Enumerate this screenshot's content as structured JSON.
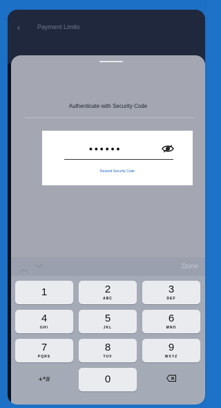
{
  "nav": {
    "title": "Payment Limits",
    "back_icon": "chevron-left-icon"
  },
  "sheet": {
    "auth_title": "Authenticate with Security Code",
    "code_value": "••••••",
    "eye_icon": "eye-icon",
    "resend_label": "Resend Security Code"
  },
  "toolbar": {
    "done_label": "Done",
    "up_icon": "chevron-up-icon",
    "down_icon": "chevron-down-icon"
  },
  "keypad": {
    "rows": [
      [
        {
          "num": "1",
          "sub": ""
        },
        {
          "num": "2",
          "sub": "ABC"
        },
        {
          "num": "3",
          "sub": "DEF"
        }
      ],
      [
        {
          "num": "4",
          "sub": "GHI"
        },
        {
          "num": "5",
          "sub": "JKL"
        },
        {
          "num": "6",
          "sub": "MNO"
        }
      ],
      [
        {
          "num": "7",
          "sub": "PQRS"
        },
        {
          "num": "8",
          "sub": "TUV"
        },
        {
          "num": "9",
          "sub": "WXYZ"
        }
      ]
    ],
    "symbols_label": "+*#",
    "zero": "0",
    "delete_icon": "backspace-icon"
  }
}
